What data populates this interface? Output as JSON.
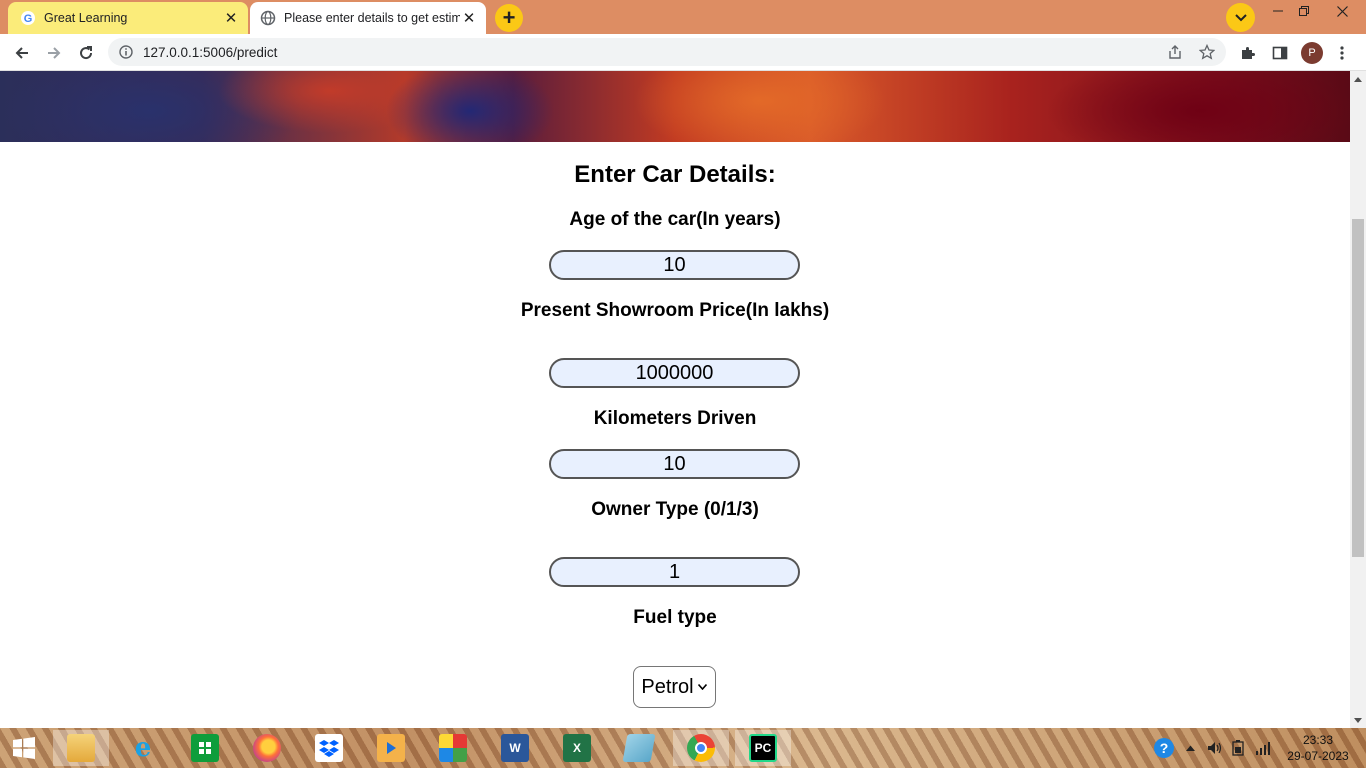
{
  "browser": {
    "tabs": [
      {
        "title": "Great Learning",
        "active": false
      },
      {
        "title": "Please enter details to get estima",
        "active": true
      }
    ],
    "url": "127.0.0.1:5006/predict",
    "profile_initial": "P",
    "colors": {
      "frame": "#dd8d63",
      "inactive_tab": "#fbec7a",
      "accent": "#fbc816"
    }
  },
  "form": {
    "heading": "Enter Car Details:",
    "fields": [
      {
        "label": "Age of the car(In years)",
        "value": "10"
      },
      {
        "label": "Present Showroom Price(In lakhs)",
        "value": "1000000"
      },
      {
        "label": "Kilometers Driven",
        "value": "10"
      },
      {
        "label": "Owner Type (0/1/3)",
        "value": "1"
      }
    ],
    "fuel": {
      "label": "Fuel type",
      "selected": "Petrol"
    }
  },
  "taskbar": {
    "apps": [
      "file-explorer",
      "internet-explorer",
      "store",
      "firefox",
      "dropbox",
      "media-player",
      "paint-app",
      "word",
      "excel",
      "notepad",
      "chrome",
      "pycharm"
    ],
    "pycharm_label": "PC",
    "clock": {
      "time": "23:33",
      "date": "29-07-2023"
    }
  }
}
